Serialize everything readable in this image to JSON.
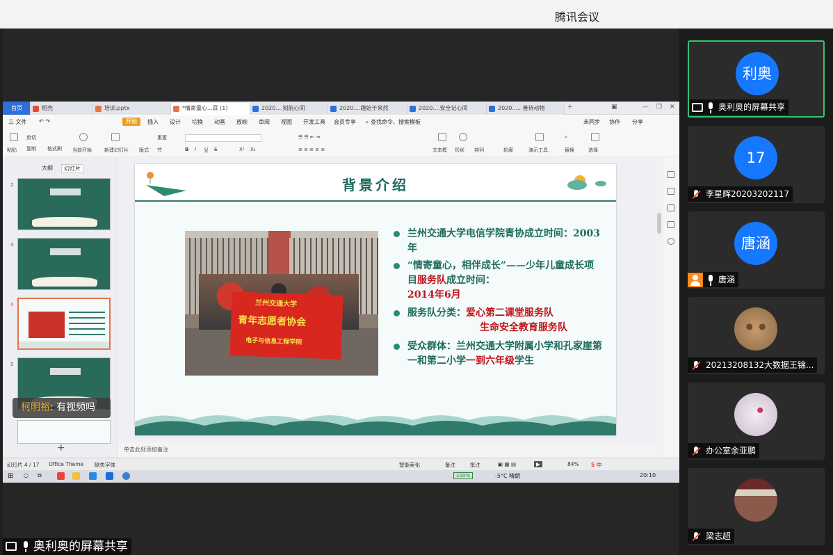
{
  "window": {
    "title": "腾讯会议"
  },
  "wps": {
    "tabs": [
      {
        "label": "首页"
      },
      {
        "label": "稻壳"
      },
      {
        "label": "培训.pptx"
      },
      {
        "label": "*情寄童心...目 (1)"
      },
      {
        "label": "2020....刻航心间"
      },
      {
        "label": "2020....趣始于来然"
      },
      {
        "label": "2020....安全记心间"
      },
      {
        "label": "2020..... 善待动物"
      }
    ],
    "menu": {
      "file": "三 文件",
      "start": "开始",
      "items": [
        "插入",
        "设计",
        "切换",
        "动画",
        "放映",
        "审阅",
        "视图",
        "开发工具",
        "会员专享"
      ],
      "search": "查找命令、搜索模板",
      "right": [
        "未同步",
        "协作",
        "分享"
      ]
    },
    "ribbon": {
      "labels": [
        "粘贴",
        "剪切",
        "复制",
        "格式刷",
        "当前开始",
        "新建幻灯片",
        "版式",
        "节",
        "重置",
        "文本框",
        "形状",
        "排列",
        "轮廓",
        "演示工具",
        "替换",
        "选择"
      ],
      "font_buttons": [
        "B",
        "I",
        "U",
        "S",
        "X²",
        "X₂"
      ]
    },
    "left_panel": {
      "tabs": [
        "大纲",
        "幻灯片"
      ],
      "slide_numbers": [
        "2",
        "3",
        "4",
        "5"
      ],
      "add": "+"
    },
    "slide": {
      "title": "背景介绍",
      "banner_line1": "兰州交通大学",
      "banner_line2": "青年志愿者协会",
      "banner_line3": "电子与信息工程学院",
      "bullets": [
        {
          "a": "兰州交通大学电信学院青协成立时间：2003年",
          "b": ""
        },
        {
          "a": "“情寄童心，相伴成长”——少年儿童成长项目",
          "b": "服务队",
          "c": "成立时间：",
          "d": "2014年6月"
        },
        {
          "a": "服务队分类：",
          "b": "爱心第二课堂服务队",
          "c": "生命安全教育服务队"
        },
        {
          "a": "受众群体：兰州交通大学附属小学和孔家崖第一和第二小学",
          "b": "一到六年级",
          "c": "学生"
        }
      ]
    },
    "notes_placeholder": "单击此处添加备注",
    "status": {
      "slide_count": "幻灯片 4 / 17",
      "theme": "Office Theme",
      "font_missing": "缺失字体",
      "beautify": "智能美化",
      "notes": "备注",
      "comments": "批注",
      "zoom": "84%"
    },
    "taskbar": {
      "battery": "100%",
      "weather": "-5°C 晴朗",
      "time": "20:10"
    }
  },
  "chat_bubble": {
    "sender": "柯明裕",
    "text": ": 有视频吗"
  },
  "sharer_label": "奥利奥的屏幕共享",
  "participants": [
    {
      "avatar_text": "利奥",
      "label": "奥利奥的屏幕共享",
      "status": "sharing"
    },
    {
      "avatar_text": "17",
      "label": "李星辉20203202117",
      "status": "muted"
    },
    {
      "avatar_text": "唐涵",
      "label": "唐涵",
      "status": "mic-on"
    },
    {
      "avatar_text": "",
      "label": "20213208132大数据王锦...",
      "status": "muted"
    },
    {
      "avatar_text": "",
      "label": "办公室余亚鹏",
      "status": "muted"
    },
    {
      "avatar_text": "",
      "label": "梁志超",
      "status": "muted"
    }
  ],
  "colors": {
    "accent": "#1677ff",
    "slide_green": "#1e6b5e",
    "slide_red": "#c0141b",
    "wps_start": "#f0a020"
  }
}
